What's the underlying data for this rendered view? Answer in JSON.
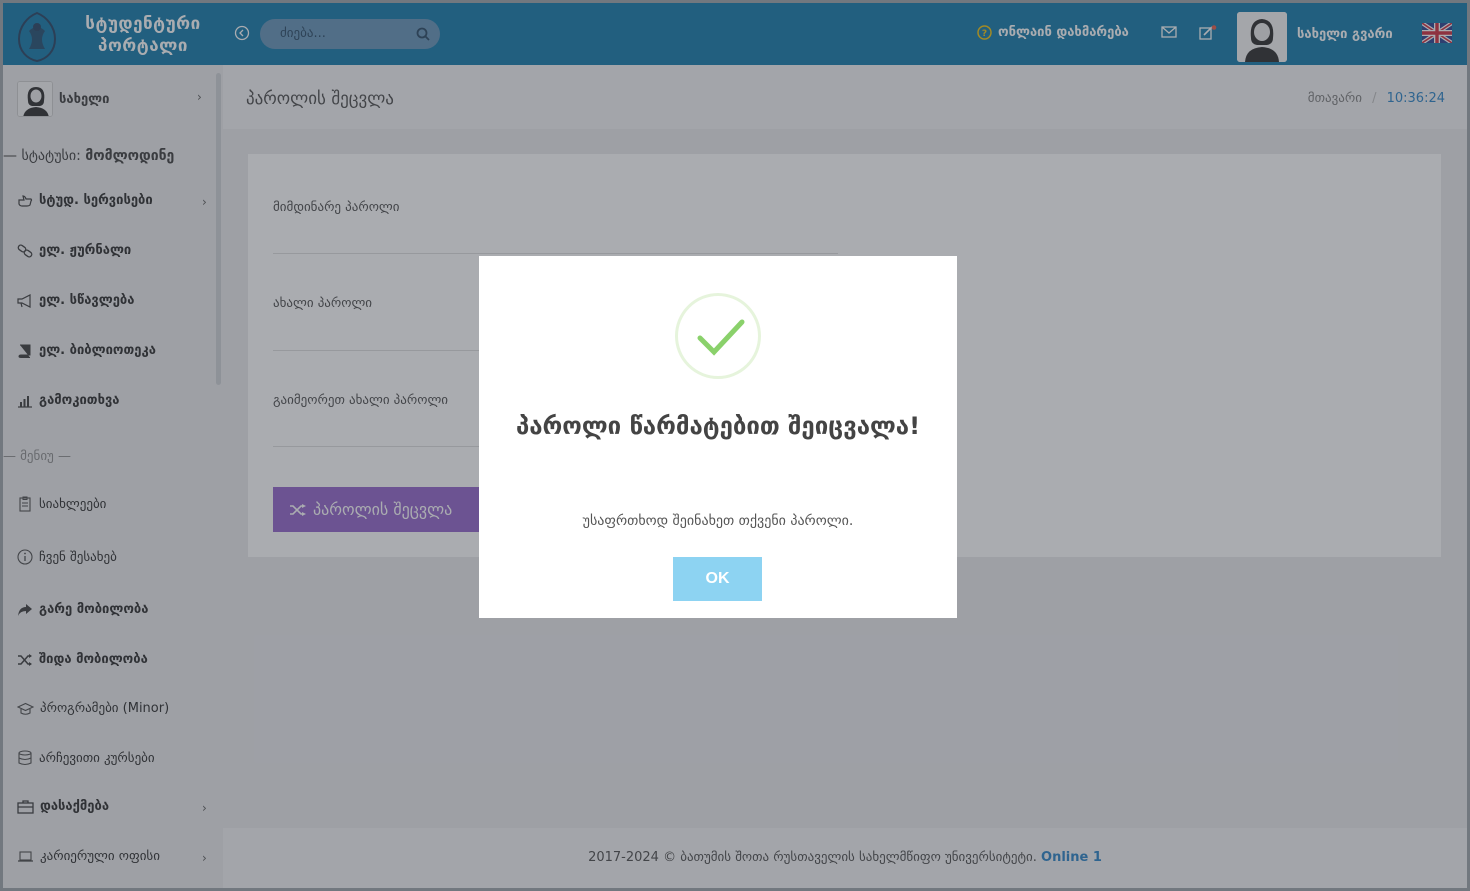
{
  "header": {
    "logo_line1": "სტუდენტური",
    "logo_line2": "პორტალი",
    "search_placeholder": "ძიება...",
    "help_label": "ონლაინ დახმარება",
    "user_name": "სახელი გვარი"
  },
  "sidebar": {
    "profile_name": "სახელი",
    "status_prefix": "— სტატუსი:",
    "status_value": "მომლოდინე",
    "section_label": "— მენიუ —",
    "items": [
      {
        "label": "სტუდ. სერვისები"
      },
      {
        "label": "ელ. ჟურნალი"
      },
      {
        "label": "ელ. სწავლება"
      },
      {
        "label": "ელ. ბიბლიოთეკა"
      },
      {
        "label": "გამოკითხვა"
      },
      {
        "label": "სიახლეები"
      },
      {
        "label": "ჩვენ შესახებ"
      },
      {
        "label": "გარე მობილობა"
      },
      {
        "label": "შიდა მობილობა"
      },
      {
        "label": "პროგრამები (Minor)"
      },
      {
        "label": "არჩევითი კურსები"
      },
      {
        "label": "დასაქმება"
      },
      {
        "label": "კარიერული ოფისი"
      }
    ]
  },
  "page": {
    "title": "პაროლის შეცვლა",
    "breadcrumb_home": "მთავარი",
    "breadcrumb_sep": "/",
    "time": "10:36:24",
    "fields": {
      "current": "მიმდინარე პაროლი",
      "new": "ახალი პაროლი",
      "repeat": "გაიმეორეთ ახალი პაროლი"
    },
    "submit_label": "პაროლის შეცვლა"
  },
  "footer": {
    "text": "2017-2024 © ბათუმის შოთა რუსთაველის სახელმწიფო უნივერსიტეტი.",
    "online": "Online 1"
  },
  "modal": {
    "title": "პაროლი წარმატებით შეიცვალა!",
    "text": "უსაფრთხოდ შეინახეთ თქვენი პაროლი.",
    "ok": "OK"
  },
  "colors": {
    "topbar": "#0874a6",
    "submit": "#8e5ec9",
    "ok_button": "#8dd3f2",
    "success_check": "#8ad16b",
    "link": "#1f7dc4"
  }
}
